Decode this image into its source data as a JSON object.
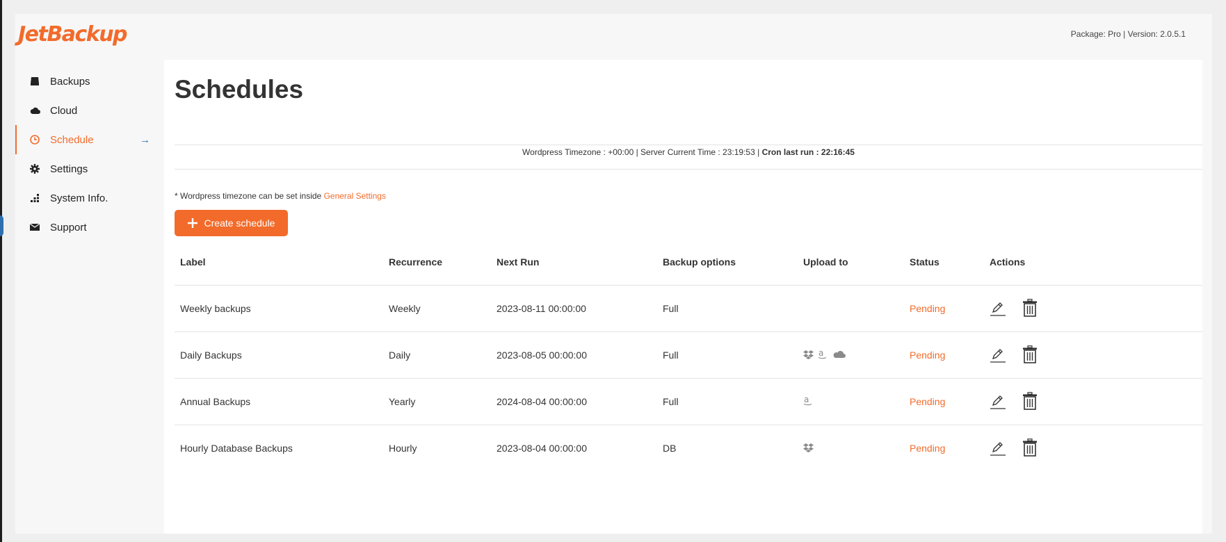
{
  "header": {
    "logo_text": "JetBackup",
    "package_info": "Package: Pro | Version: 2.0.5.1"
  },
  "sidebar": {
    "items": [
      {
        "label": "Backups",
        "icon": "drive-icon"
      },
      {
        "label": "Cloud",
        "icon": "cloud-icon"
      },
      {
        "label": "Schedule",
        "icon": "clock-icon",
        "active": true,
        "arrow": "→"
      },
      {
        "label": "Settings",
        "icon": "gear-icon"
      },
      {
        "label": "System Info.",
        "icon": "bar-chart-icon"
      },
      {
        "label": "Support",
        "icon": "envelope-icon"
      }
    ]
  },
  "main": {
    "title": "Schedules",
    "time_info": "Wordpress Timezone : +00:00 | Server Current Time : 23:19:53 |",
    "cron_info": "Cron last run : 22:16:45",
    "tz_note": "* Wordpress timezone can be set inside",
    "tz_link": "General Settings",
    "create_button": "Create schedule",
    "table": {
      "headers": [
        "Label",
        "Recurrence",
        "Next Run",
        "Backup options",
        "Upload to",
        "Status",
        "Actions"
      ],
      "rows": [
        {
          "label": "Weekly backups",
          "recurrence": "Weekly",
          "next_run": "2023-08-11 00:00:00",
          "options": "Full",
          "upload": [],
          "status": "Pending"
        },
        {
          "label": "Daily Backups",
          "recurrence": "Daily",
          "next_run": "2023-08-05 00:00:00",
          "options": "Full",
          "upload": [
            "dropbox-icon",
            "amazon-icon",
            "onedrive-icon"
          ],
          "status": "Pending"
        },
        {
          "label": "Annual Backups",
          "recurrence": "Yearly",
          "next_run": "2024-08-04 00:00:00",
          "options": "Full",
          "upload": [
            "amazon-icon"
          ],
          "status": "Pending"
        },
        {
          "label": "Hourly Database Backups",
          "recurrence": "Hourly",
          "next_run": "2023-08-04 00:00:00",
          "options": "DB",
          "upload": [
            "dropbox-icon"
          ],
          "status": "Pending"
        }
      ]
    }
  },
  "colors": {
    "accent": "#f26b2b",
    "arrow": "#2e6fb0"
  }
}
